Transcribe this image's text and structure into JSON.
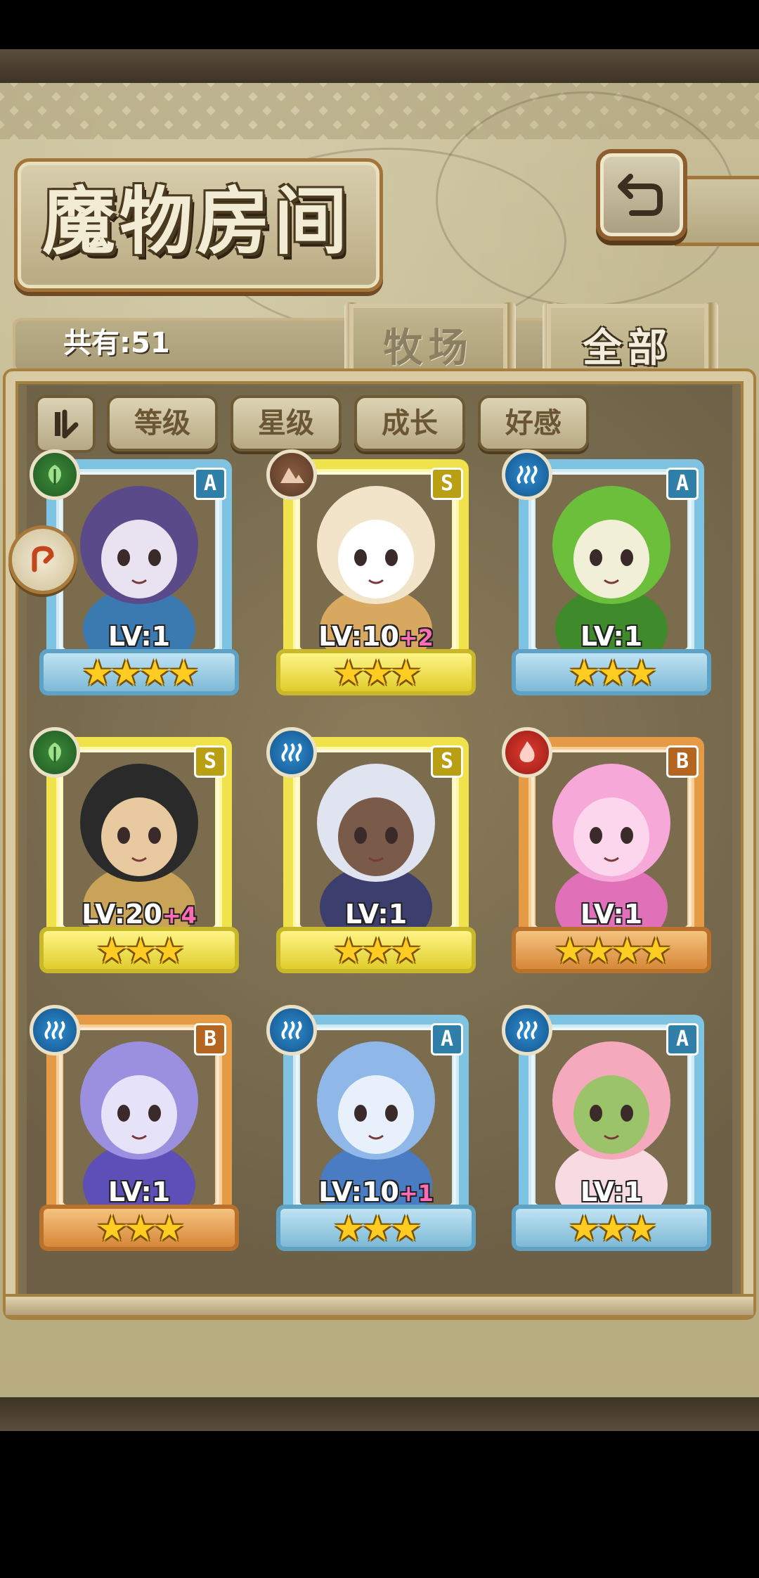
{
  "header": {
    "title": "魔物房间",
    "back_icon": "return-arrow-icon"
  },
  "summary": {
    "count_label": "共有:51"
  },
  "tabs": [
    {
      "label": "牧场",
      "active": false
    },
    {
      "label": "全部",
      "active": true
    }
  ],
  "filters": {
    "sort_toggle_icon": "sort-order-icon",
    "buttons": [
      "等级",
      "星级",
      "成长",
      "好感"
    ]
  },
  "colors": {
    "rank_A": "#7ec4e2",
    "rank_S": "#f0e24a",
    "rank_B": "#e59a45",
    "plus_level": "#ff6bb5",
    "star": "#ffcc22"
  },
  "monsters": [
    {
      "rank": "A",
      "element": "wood",
      "level": "LV:1",
      "plus": "",
      "stars": 4,
      "palette": [
        "#5b4a8a",
        "#e9e2f0",
        "#3a7ab0"
      ]
    },
    {
      "rank": "S",
      "element": "earth",
      "level": "LV:10",
      "plus": "+2",
      "stars": 3,
      "palette": [
        "#f2e4c8",
        "#ffffff",
        "#d8a860"
      ]
    },
    {
      "rank": "A",
      "element": "water",
      "level": "LV:1",
      "plus": "",
      "stars": 3,
      "palette": [
        "#6cbf3a",
        "#f2efd8",
        "#3f8a2a"
      ]
    },
    {
      "rank": "S",
      "element": "wood",
      "level": "LV:20",
      "plus": "+4",
      "stars": 3,
      "palette": [
        "#2a2a2a",
        "#e8c9a0",
        "#c9a458"
      ]
    },
    {
      "rank": "S",
      "element": "water",
      "level": "LV:1",
      "plus": "",
      "stars": 3,
      "palette": [
        "#dfe4f0",
        "#7a5a48",
        "#3c3f6e"
      ]
    },
    {
      "rank": "B",
      "element": "fire",
      "level": "LV:1",
      "plus": "",
      "stars": 4,
      "palette": [
        "#f6a8d8",
        "#fbd6ec",
        "#e070b8"
      ]
    },
    {
      "rank": "B",
      "element": "water",
      "level": "LV:1",
      "plus": "",
      "stars": 3,
      "palette": [
        "#9b90e0",
        "#e6e2f8",
        "#5c4fb8"
      ]
    },
    {
      "rank": "A",
      "element": "water",
      "level": "LV:10",
      "plus": "+1",
      "stars": 3,
      "palette": [
        "#8fb7e8",
        "#e8f1fb",
        "#4a7cc4"
      ]
    },
    {
      "rank": "A",
      "element": "water",
      "level": "LV:1",
      "plus": "",
      "stars": 3,
      "palette": [
        "#f4a9bd",
        "#9bc46a",
        "#f8dbe2"
      ]
    }
  ]
}
